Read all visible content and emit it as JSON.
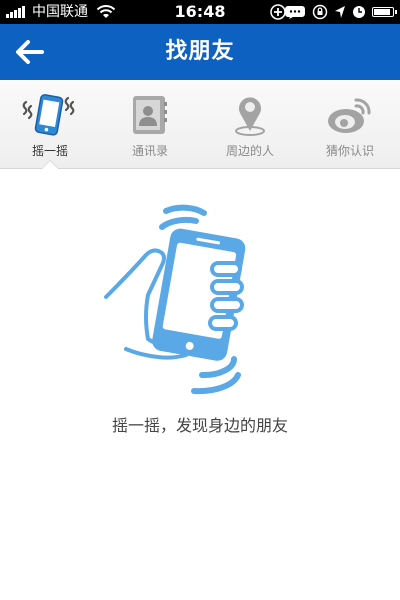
{
  "status_bar": {
    "carrier": "中国联通",
    "time": "16:48"
  },
  "nav": {
    "title": "找朋友"
  },
  "tabs": [
    {
      "label": "摇一摇",
      "icon": "shake-phone-icon",
      "active": true
    },
    {
      "label": "通讯录",
      "icon": "contacts-icon",
      "active": false
    },
    {
      "label": "周边的人",
      "icon": "location-pin-icon",
      "active": false
    },
    {
      "label": "猜你认识",
      "icon": "weibo-icon",
      "active": false
    }
  ],
  "main": {
    "illustration": "hand-shaking-phone-icon",
    "hint": "摇一摇，发现身边的朋友"
  },
  "colors": {
    "nav_blue": "#0d62c1",
    "accent_blue": "#3a8fe0",
    "illustration_blue": "#5aa9e6",
    "inactive_gray": "#9a9a9a"
  }
}
